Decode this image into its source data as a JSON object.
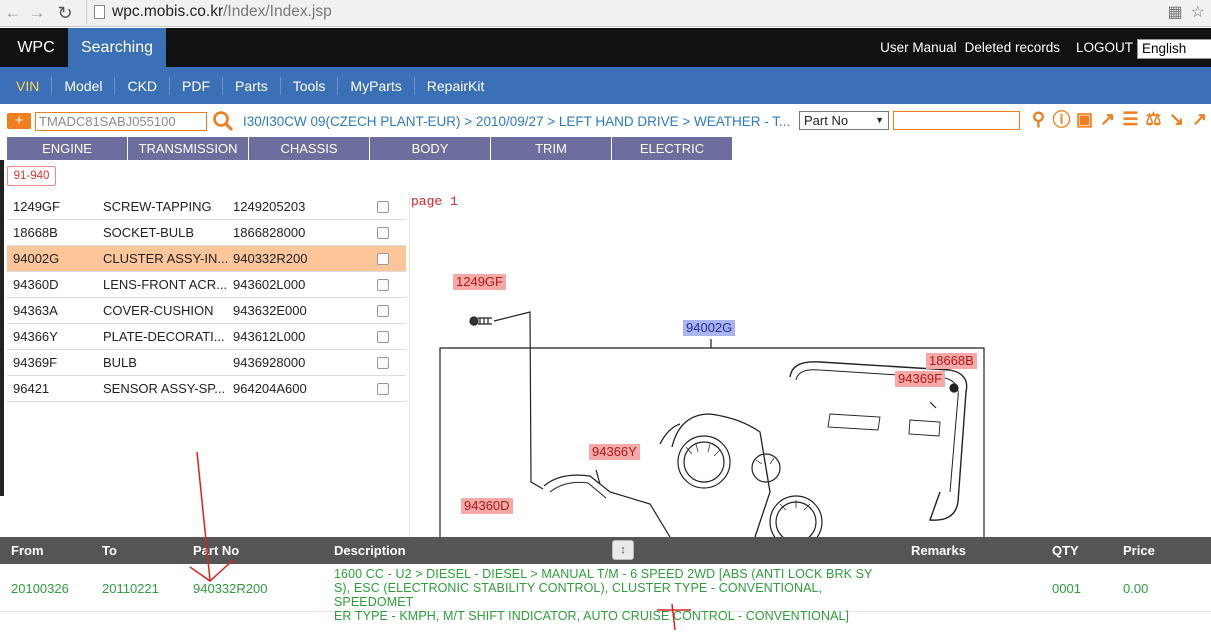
{
  "browser": {
    "url_host": "wpc.mobis.co.kr",
    "url_path": "/Index/Index.jsp"
  },
  "header": {
    "brand": "WPC",
    "active_tab": "Searching",
    "links": [
      "User Manual",
      "Deleted records",
      "LOGOUT"
    ],
    "language": "English"
  },
  "menu": {
    "items": [
      "VIN",
      "Model",
      "CKD",
      "PDF",
      "Parts",
      "Tools",
      "MyParts",
      "RepairKit"
    ],
    "active": "VIN"
  },
  "search": {
    "plus": "+",
    "vin_value": "TMADC81SABJ055100",
    "breadcrumb": "I30/I30CW 09(CZECH PLANT-EUR) > 2010/09/27 > LEFT HAND DRIVE > WEATHER - T...",
    "search_by": "Part No",
    "part_no_value": ""
  },
  "categories": [
    "ENGINE",
    "TRANSMISSION",
    "CHASSIS",
    "BODY",
    "TRIM",
    "ELECTRIC"
  ],
  "group": "91-940",
  "parts": [
    {
      "ref": "1249GF",
      "name": "SCREW-TAPPING",
      "number": "1249205203"
    },
    {
      "ref": "18668B",
      "name": "SOCKET-BULB",
      "number": "1866828000"
    },
    {
      "ref": "94002G",
      "name": "CLUSTER ASSY-IN...",
      "number": "940332R200"
    },
    {
      "ref": "94360D",
      "name": "LENS-FRONT ACR...",
      "number": "943602L000"
    },
    {
      "ref": "94363A",
      "name": "COVER-CUSHION",
      "number": "943632E000"
    },
    {
      "ref": "94366Y",
      "name": "PLATE-DECORATI...",
      "number": "943612L000"
    },
    {
      "ref": "94369F",
      "name": "BULB",
      "number": "9436928000"
    },
    {
      "ref": "96421",
      "name": "SENSOR ASSY-SP...",
      "number": "964204A600"
    }
  ],
  "selected_part": "94002G",
  "diagram": {
    "page_label": "page 1",
    "callouts": [
      "1249GF",
      "94002G",
      "18668B",
      "94369F",
      "94366Y",
      "94360D"
    ]
  },
  "detail": {
    "headers": {
      "from": "From",
      "to": "To",
      "part_no": "Part No",
      "description": "Description",
      "remarks": "Remarks",
      "qty": "QTY",
      "price": "Price"
    },
    "sort_handle": "↕",
    "row": {
      "from": "20100326",
      "to": "20110221",
      "part_no": "940332R200",
      "description_lines": [
        "1600 CC - U2 > DIESEL - DIESEL > MANUAL T/M - 6 SPEED 2WD [ABS (ANTI LOCK BRK SY",
        "S), ESC (ELECTRONIC STABILITY CONTROL), CLUSTER TYPE - CONVENTIONAL, SPEEDOMET",
        "ER TYPE - KMPH, M/T SHIFT INDICATOR, AUTO CRUISE CONTROL - CONVENTIONAL]"
      ],
      "remarks": "",
      "qty": "0001",
      "price": "0.00"
    }
  },
  "colors": {
    "menu_bg": "#3b6fb6",
    "accent_orange": "#f07e1c",
    "category_tab": "#6d6d9e",
    "selected_row": "#fcc59a",
    "detail_text": "#2e9e3a",
    "annotation_red": "#e02020"
  }
}
